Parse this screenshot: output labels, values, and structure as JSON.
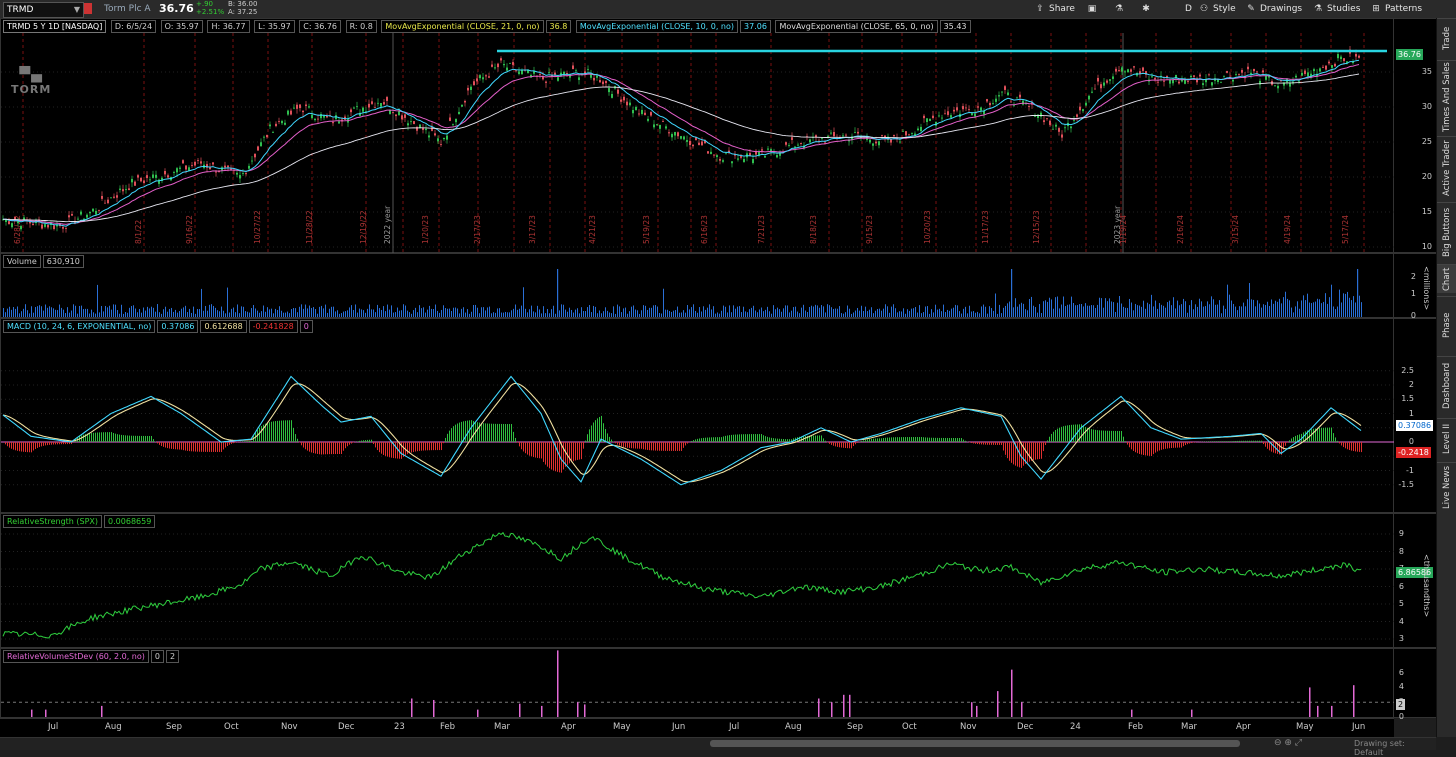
{
  "toolbar": {
    "symbol": "TRMD",
    "company": "Torm Plc A",
    "last": "36.76",
    "change": "+.90",
    "change_pct": "+2.51%",
    "bid": "B: 36.00",
    "ask": "A: 37.25",
    "buttons": [
      {
        "label": "Share",
        "icon": "share-icon"
      },
      {
        "label": "",
        "icon": "snapshot-icon"
      },
      {
        "label": "",
        "icon": "flask-icon"
      },
      {
        "label": "",
        "icon": "gear-icon"
      },
      {
        "label": "D",
        "icon": "aggregation-icon"
      },
      {
        "label": "Style",
        "icon": "style-icon"
      },
      {
        "label": "Drawings",
        "icon": "pencil-icon"
      },
      {
        "label": "Studies",
        "icon": "studies-icon"
      },
      {
        "label": "Patterns",
        "icon": "patterns-icon"
      }
    ]
  },
  "sidebar": {
    "tabs": [
      "Trade",
      "Times And Sales",
      "Active Trader",
      "Big Buttons",
      "Chart",
      "Phase Scores",
      "Dashboard",
      "Level II",
      "Live News"
    ],
    "active": "Chart"
  },
  "price_pane": {
    "header": "TRMD 5 Y 1D [NASDAQ]",
    "date": "D: 6/5/24",
    "open": "O: 35.97",
    "high": "H: 36.77",
    "low": "L: 35.97",
    "close": "C: 36.76",
    "range": "R: 0.8",
    "studies": [
      {
        "label": "MovAvgExponential (CLOSE, 21, 0, no)",
        "value": "36.8"
      },
      {
        "label": "MovAvgExponential (CLOSE, 10, 0, no)",
        "value": "37.06"
      },
      {
        "label": "MovAvgExponential (CLOSE, 65, 0, no)",
        "value": "35.43"
      }
    ],
    "last_badge": "36.76",
    "watermark": "TORM",
    "y_ticks": [
      "35",
      "30",
      "25",
      "20",
      "15",
      "10"
    ],
    "date_markers": [
      "6/28/22",
      "8/1/22",
      "9/16/22",
      "10/27/22",
      "11/28/22",
      "12/19/22",
      "2022 year",
      "1/20/23",
      "2/17/23",
      "3/17/23",
      "4/21/23",
      "5/19/23",
      "6/16/23",
      "7/21/23",
      "8/18/23",
      "9/15/23",
      "10/20/23",
      "11/17/23",
      "12/15/23",
      "2023 year",
      "1/19/24",
      "2/16/24",
      "3/15/24",
      "4/19/24",
      "5/17/24"
    ],
    "resistance_color": "#29d4e0"
  },
  "volume_pane": {
    "label": "Volume",
    "value": "630,910",
    "unit": "<millions>",
    "y_ticks": [
      "2",
      "1",
      "0"
    ]
  },
  "macd_pane": {
    "label": "MACD (10, 24, 6, EXPONENTIAL, no)",
    "value": "0.37086",
    "avg": "0.612688",
    "diff": "-0.241828",
    "zero": "0",
    "badge_value": "0.37086",
    "badge_diff": "-0.2418",
    "y_ticks": [
      "2.5",
      "2",
      "1.5",
      "1",
      "0.5",
      "0",
      "-0.5",
      "-1",
      "-1.5"
    ]
  },
  "rs_pane": {
    "label": "RelativeStrength (SPX)",
    "value": "0.0068659",
    "badge": "6.86586",
    "unit": "<thousandths>",
    "y_ticks": [
      "9",
      "8",
      "7",
      "6",
      "5",
      "4",
      "3"
    ]
  },
  "rvol_pane": {
    "label": "RelativeVolumeStDev (60, 2.0, no)",
    "v1": "0",
    "v2": "2",
    "badge": "2",
    "y_ticks": [
      "6",
      "4",
      "2",
      "0"
    ]
  },
  "x_axis": [
    "Jul",
    "Aug",
    "Sep",
    "Oct",
    "Nov",
    "Dec",
    "23",
    "Feb",
    "Mar",
    "Apr",
    "May",
    "Jun",
    "Jul",
    "Aug",
    "Sep",
    "Oct",
    "Nov",
    "Dec",
    "24",
    "Feb",
    "Mar",
    "Apr",
    "May",
    "Jun"
  ],
  "footer": {
    "status": "Drawing set: Default"
  }
}
